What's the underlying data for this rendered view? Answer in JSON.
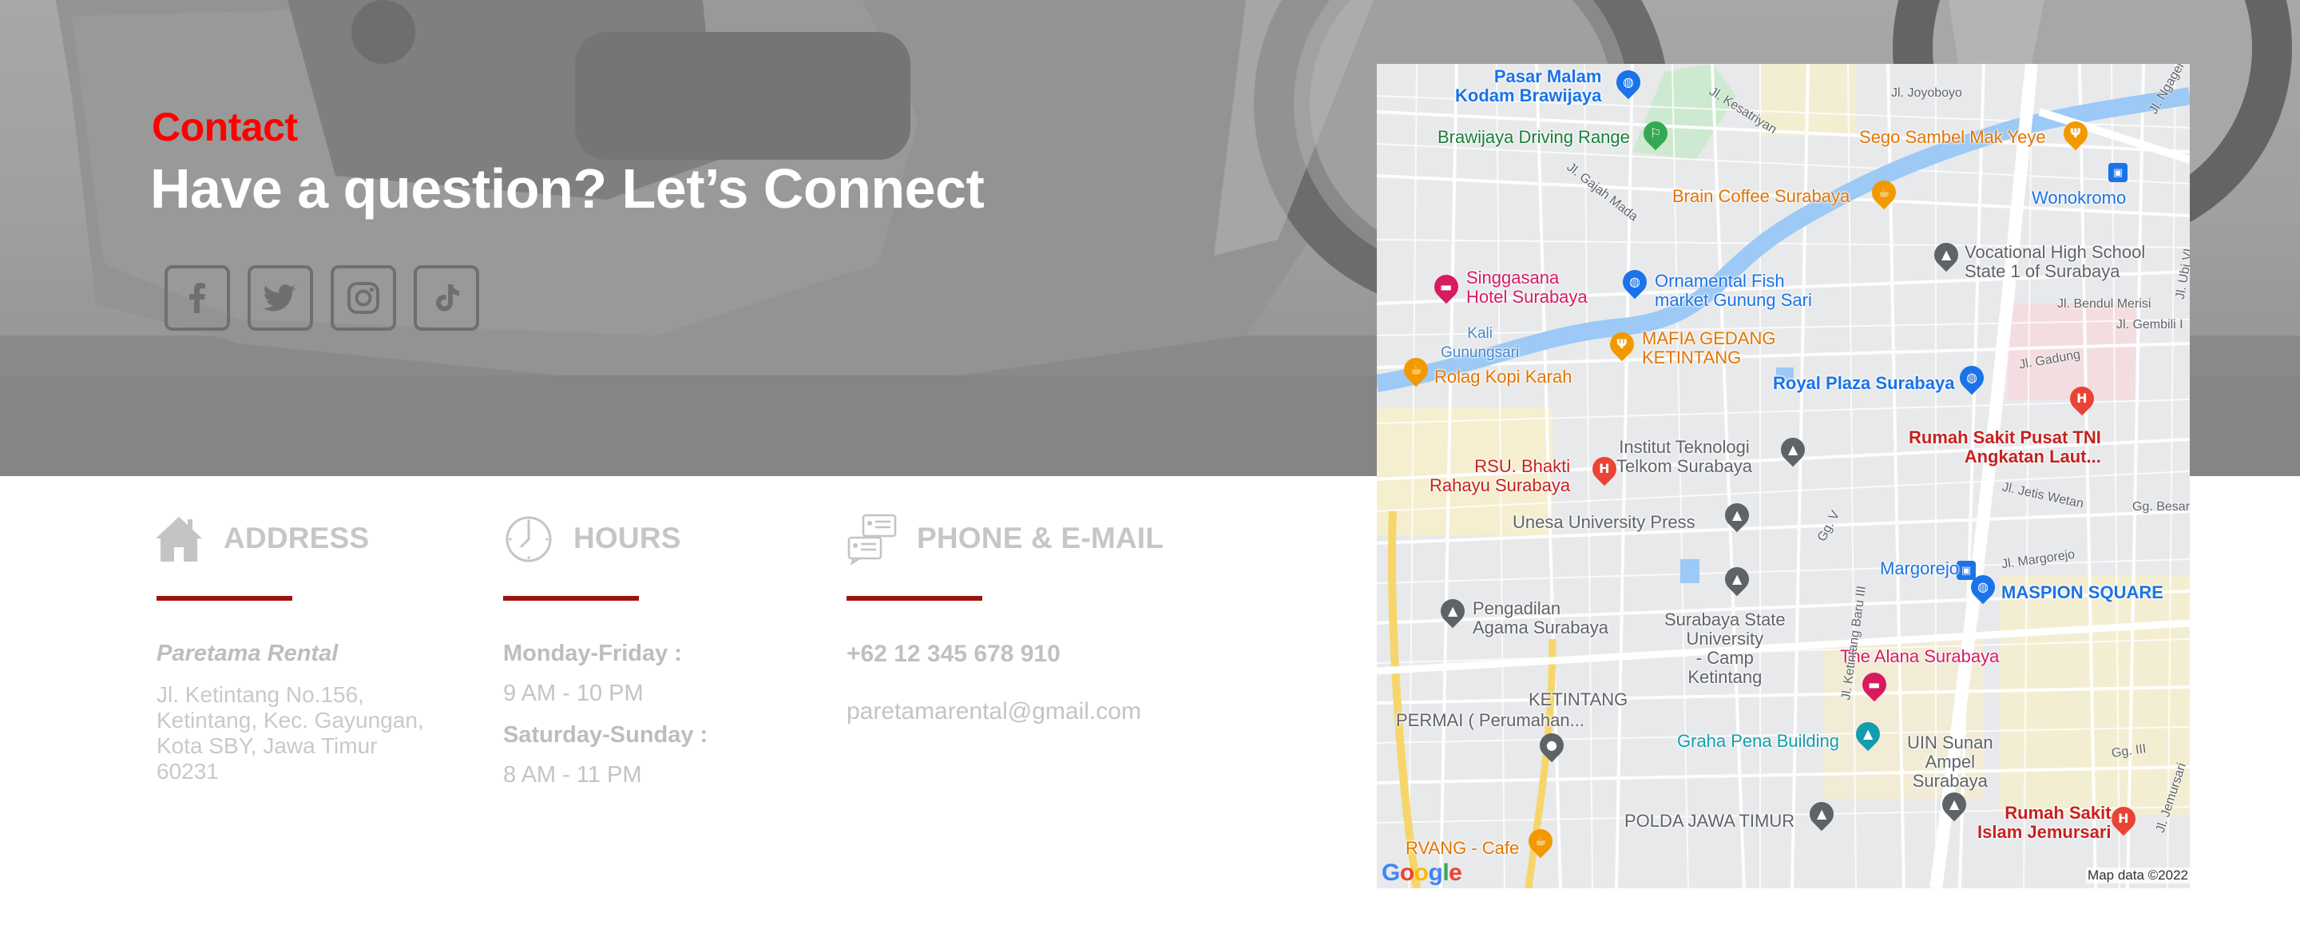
{
  "hero": {
    "eyebrow": "Contact",
    "headline": "Have a question? Let’s Connect",
    "socials": [
      {
        "icon": "facebook-icon"
      },
      {
        "icon": "twitter-icon"
      },
      {
        "icon": "instagram-icon"
      },
      {
        "icon": "tiktok-icon"
      }
    ]
  },
  "address": {
    "title": "ADDRESS",
    "icon": "house-icon",
    "name": "Paretama Rental",
    "text": "Jl. Ketintang No.156, Ketintang, Kec. Gayungan, Kota SBY, Jawa Timur 60231"
  },
  "hours": {
    "title": "HOURS",
    "icon": "clock-icon",
    "weekday_label": "Monday-Friday :",
    "weekday_time": "9 AM - 10 PM",
    "weekend_label": "Saturday-Sunday :",
    "weekend_time": "8 AM - 11 PM"
  },
  "contact": {
    "title": "PHONE & E-MAIL",
    "icon": "chat-cards-icon",
    "phone": "+62 12 345 678 910",
    "email": "paretamarental@gmail.com"
  },
  "colors": {
    "accent_red": "#ff0000",
    "divider_red": "#9d1414",
    "muted_text": "#c4c4c4"
  },
  "map": {
    "places": [
      {
        "label": "Pasar Malam\nKodam Brawijaya",
        "color": "#1a73e8"
      },
      {
        "label": "Brawijaya Driving Range",
        "color": "#188038"
      },
      {
        "label": "Sego Sambel Mak Yeye",
        "color": "#e37400"
      },
      {
        "label": "Wonokromo",
        "color": "#1a73e8"
      },
      {
        "label": "Brain Coffee Surabaya",
        "color": "#e37400"
      },
      {
        "label": "Vocational High School\nState 1 of Surabaya",
        "color": "#5f6368"
      },
      {
        "label": "Singgasana\nHotel Surabaya",
        "color": "#d81b60"
      },
      {
        "label": "Ornamental Fish\nmarket Gunung Sari",
        "color": "#1a73e8"
      },
      {
        "label": "Kali\nGunungsari",
        "color": "#4a86c5"
      },
      {
        "label": "MAFIA GEDANG\nKETINTANG",
        "color": "#e37400"
      },
      {
        "label": "Rolag Kopi Karah",
        "color": "#e37400"
      },
      {
        "label": "Royal Plaza Surabaya",
        "color": "#1a73e8"
      },
      {
        "label": "Rumah Sakit Pusat TNI\nAngkatan Laut...",
        "color": "#c5221f"
      },
      {
        "label": "Institut Teknologi\nTelkom Surabaya",
        "color": "#5f6368"
      },
      {
        "label": "RSU. Bhakti\nRahayu Surabaya",
        "color": "#c5221f"
      },
      {
        "label": "Unesa University Press",
        "color": "#5f6368"
      },
      {
        "label": "Margorejo",
        "color": "#1a73e8"
      },
      {
        "label": "MASPION SQUARE",
        "color": "#1a73e8"
      },
      {
        "label": "Pengadilan\nAgama Surabaya",
        "color": "#5f6368"
      },
      {
        "label": "Surabaya State\nUniversity\n- Camp\nKetintang",
        "color": "#5f6368"
      },
      {
        "label": "The Alana Surabaya",
        "color": "#d81b60"
      },
      {
        "label": "KETINTANG",
        "color": "#5f6368"
      },
      {
        "label": "PERMAI ( Perumahan...",
        "color": "#5f6368"
      },
      {
        "label": "Graha Pena Building",
        "color": "#129eaf"
      },
      {
        "label": "UIN Sunan\nAmpel\nSurabaya",
        "color": "#5f6368"
      },
      {
        "label": "Rumah Sakit\nIslam Jemursari",
        "color": "#c5221f"
      },
      {
        "label": "POLDA JAWA TIMUR",
        "color": "#5f6368"
      },
      {
        "label": "RVANG - Cafe",
        "color": "#e37400"
      }
    ],
    "streets": [
      "Jl. Joyoboyo",
      "Jl. Kesatriyan",
      "Jl. Gajah Mada",
      "Jl. Ngagel",
      "Jl. Ubi VI",
      "Jl. Bendul Merisi",
      "Jl. Gembili I",
      "Jl. Gadung",
      "Gg. Besar S",
      "Jl. Jetis Wetan",
      "Gg. V",
      "Jl. Margorejo",
      "Jl. Ketintang Baru III",
      "Gg. III",
      "Jl. Jemursari"
    ],
    "logo": "Google",
    "credit": "Map data ©2022"
  }
}
